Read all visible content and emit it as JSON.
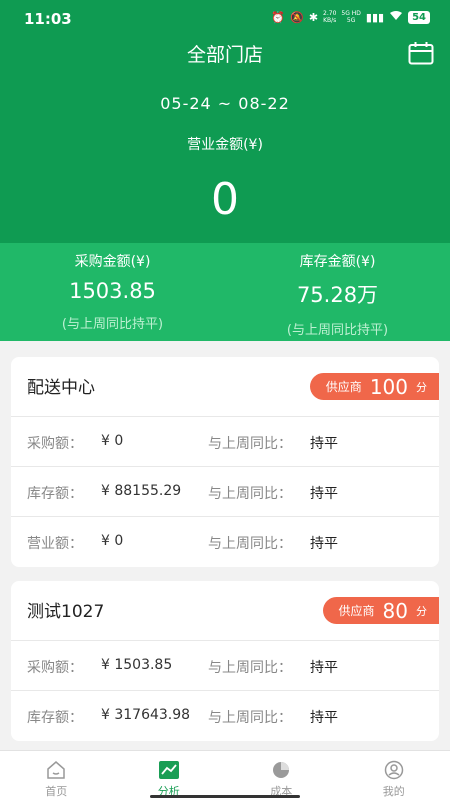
{
  "status_bar": {
    "time": "11:03",
    "network_speed_top": "2.70",
    "network_speed_bottom": "KB/s",
    "network_type_top": "5G HD",
    "network_type_bottom": "5G",
    "battery": "54"
  },
  "header": {
    "title": "全部门店",
    "date_range": "05-24 ~ 08-22",
    "revenue_label": "营业金额(¥)",
    "revenue_value": "0"
  },
  "summary": {
    "purchase_label": "采购金额(¥)",
    "purchase_value": "1503.85",
    "purchase_compare": "(与上周同比持平)",
    "inventory_label": "库存金额(¥)",
    "inventory_value": "75.28万",
    "inventory_compare": "(与上周同比持平)"
  },
  "cards": [
    {
      "title": "配送中心",
      "badge_label": "供应商",
      "badge_score": "100",
      "badge_unit": "分",
      "rows": [
        {
          "label": "采购额：",
          "value": "¥ 0",
          "compare_label": "与上周同比：",
          "compare_value": "持平"
        },
        {
          "label": "库存额：",
          "value": "¥ 88155.29",
          "compare_label": "与上周同比：",
          "compare_value": "持平"
        },
        {
          "label": "营业额：",
          "value": "¥ 0",
          "compare_label": "与上周同比：",
          "compare_value": "持平"
        }
      ]
    },
    {
      "title": "测试1027",
      "badge_label": "供应商",
      "badge_score": "80",
      "badge_unit": "分",
      "rows": [
        {
          "label": "采购额：",
          "value": "¥ 1503.85",
          "compare_label": "与上周同比：",
          "compare_value": "持平"
        },
        {
          "label": "库存额：",
          "value": "¥ 317643.98",
          "compare_label": "与上周同比：",
          "compare_value": "持平"
        }
      ]
    }
  ],
  "tabbar": {
    "items": [
      {
        "label": "首页",
        "icon": "home-icon"
      },
      {
        "label": "分析",
        "icon": "trend-chart-icon",
        "active": true
      },
      {
        "label": "成本",
        "icon": "pie-chart-icon"
      },
      {
        "label": "我的",
        "icon": "user-icon"
      }
    ]
  },
  "colors": {
    "header_green": "#0f9b52",
    "summary_green": "#20b868",
    "badge_orange": "#f0674a",
    "tab_active": "#1a9e55"
  }
}
